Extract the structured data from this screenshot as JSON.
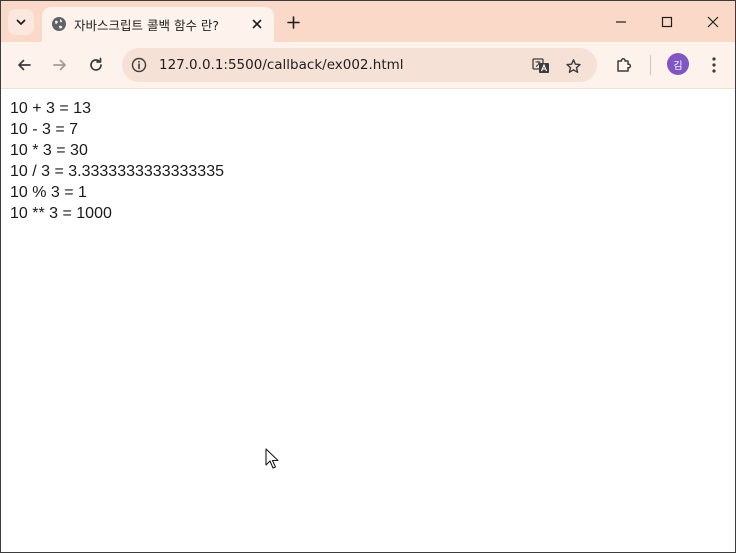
{
  "browser": {
    "tab": {
      "title": "자바스크립트 콜백 함수 란?"
    },
    "address_bar": {
      "url": "127.0.0.1:5500/callback/ex002.html"
    },
    "profile": {
      "initial": "김",
      "color": "#7e57c2"
    },
    "theme": {
      "tabstrip_color": "#fbd9c8",
      "toolbar_color": "#fdf2ec"
    }
  },
  "page": {
    "lines": [
      "10 + 3 = 13",
      "10 - 3 = 7",
      "10 * 3 = 30",
      "10 / 3 = 3.3333333333333335",
      "10 % 3 = 1",
      "10 ** 3 = 1000"
    ]
  }
}
